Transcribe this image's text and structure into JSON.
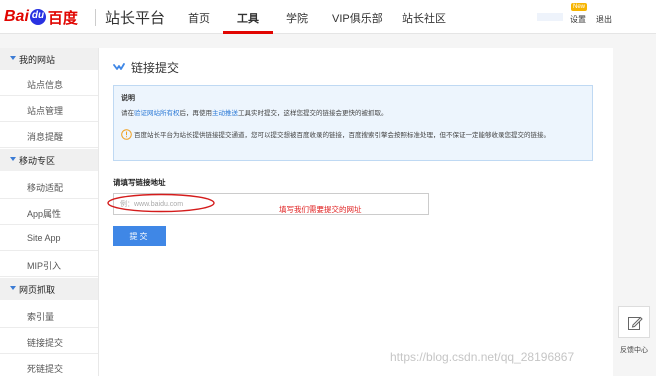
{
  "header": {
    "logo": {
      "bai": "Bai",
      "du": "du",
      "cn": "百度"
    },
    "site_title": "站长平台",
    "nav": [
      {
        "label": "首页",
        "active": false
      },
      {
        "label": "工具",
        "active": true
      },
      {
        "label": "学院",
        "active": false
      },
      {
        "label": "VIP俱乐部",
        "active": false
      },
      {
        "label": "站长社区",
        "active": false
      }
    ],
    "new_badge": "New",
    "settings": "设置",
    "logout": "退出"
  },
  "sidebar": {
    "groups": [
      {
        "label": "我的网站",
        "items": [
          "站点信息",
          "站点管理",
          "消息提醒"
        ]
      },
      {
        "label": "移动专区",
        "items": [
          "移动适配",
          "App属性",
          "Site App",
          "MIP引入"
        ]
      },
      {
        "label": "网页抓取",
        "items": [
          "索引量",
          "链接提交",
          "死链提交"
        ]
      }
    ]
  },
  "main": {
    "title": "链接提交",
    "info": {
      "heading": "说明",
      "line1_pre": "请在",
      "line1_link1": "验证网站所有权",
      "line1_mid": "后，再使用",
      "line1_link2": "主动推送",
      "line1_post": "工具实时提交，这样您提交的链接会更快的被抓取。",
      "line2": "百度站长平台为站长提供链接提交通道，您可以提交想被百度收录的链接，百度搜索引擎会按照标准处理，但不保证一定能够收录您提交的链接。"
    },
    "form_label": "请填写链接地址",
    "input_placeholder": "例：www.baidu.com",
    "annotation": "填写我们需要提交的网址",
    "submit_label": "提交"
  },
  "feedback": {
    "label": "反馈中心"
  },
  "watermark": "https://blog.csdn.net/qq_28196867",
  "colors": {
    "brand_red": "#e10602",
    "brand_blue": "#2932e1",
    "button_blue": "#3f87e6",
    "info_bg": "#edf5fd"
  }
}
